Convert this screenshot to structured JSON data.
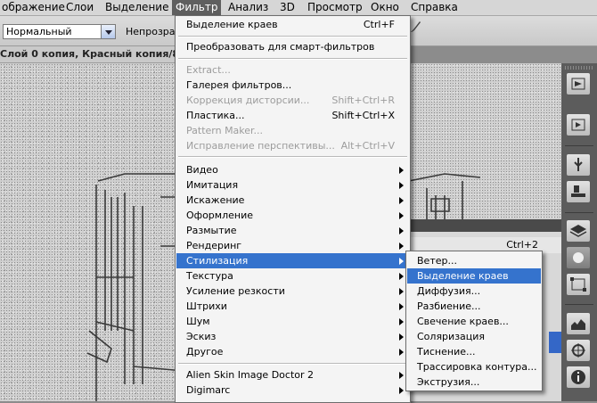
{
  "menubar": {
    "items": [
      "ображение",
      "Слои",
      "Выделение",
      "Фильтр",
      "Анализ",
      "3D",
      "Просмотр",
      "Окно",
      "Справка"
    ],
    "active_index": 3
  },
  "options": {
    "blend_mode": "Нормальный",
    "opacity_label": "Непрозрач"
  },
  "document": {
    "tab_title": "Слой 0 копия, Красный копия/8) *"
  },
  "filter_menu": {
    "items": [
      {
        "label": "Выделение краев",
        "shortcut": "Ctrl+F",
        "disabled": false
      },
      {
        "label": "Преобразовать для смарт-фильтров",
        "shortcut": "",
        "disabled": false
      },
      {
        "label": "Extract...",
        "shortcut": "",
        "disabled": true
      },
      {
        "label": "Галерея фильтров...",
        "shortcut": "",
        "disabled": false
      },
      {
        "label": "Коррекция дисторсии...",
        "shortcut": "Shift+Ctrl+R",
        "disabled": true
      },
      {
        "label": "Пластика...",
        "shortcut": "Shift+Ctrl+X",
        "disabled": false
      },
      {
        "label": "Pattern Maker...",
        "shortcut": "",
        "disabled": true
      },
      {
        "label": "Исправление перспективы...",
        "shortcut": "Alt+Ctrl+V",
        "disabled": true
      },
      {
        "label": "Видео",
        "submenu": true
      },
      {
        "label": "Имитация",
        "submenu": true
      },
      {
        "label": "Искажение",
        "submenu": true
      },
      {
        "label": "Оформление",
        "submenu": true
      },
      {
        "label": "Размытие",
        "submenu": true
      },
      {
        "label": "Рендеринг",
        "submenu": true
      },
      {
        "label": "Стилизация",
        "submenu": true,
        "highlighted": true
      },
      {
        "label": "Текстура",
        "submenu": true
      },
      {
        "label": "Усиление резкости",
        "submenu": true
      },
      {
        "label": "Штрихи",
        "submenu": true
      },
      {
        "label": "Шум",
        "submenu": true
      },
      {
        "label": "Эскиз",
        "submenu": true
      },
      {
        "label": "Другое",
        "submenu": true
      },
      {
        "label": "Alien Skin Image Doctor 2",
        "submenu": true
      },
      {
        "label": "Digimarc",
        "submenu": true
      }
    ]
  },
  "stylize_menu": {
    "items": [
      {
        "label": "Ветер..."
      },
      {
        "label": "Выделение краев",
        "highlighted": true
      },
      {
        "label": "Диффузия..."
      },
      {
        "label": "Разбиение..."
      },
      {
        "label": "Свечение краев..."
      },
      {
        "label": "Соляризация"
      },
      {
        "label": "Тиснение..."
      },
      {
        "label": "Трассировка контура..."
      },
      {
        "label": "Экструзия..."
      }
    ]
  },
  "side_panel": {
    "shortcut": "Ctrl+2"
  },
  "dock": {
    "icons": [
      "play-icon",
      "action-play-icon",
      "usb-icon",
      "stamp-icon",
      "layers-icon",
      "channels-icon",
      "transform-icon",
      "histogram-icon",
      "navigator-icon",
      "info-icon"
    ]
  },
  "colors": {
    "highlight": "#3573cd",
    "menubar_active": "#5f5f5f"
  }
}
